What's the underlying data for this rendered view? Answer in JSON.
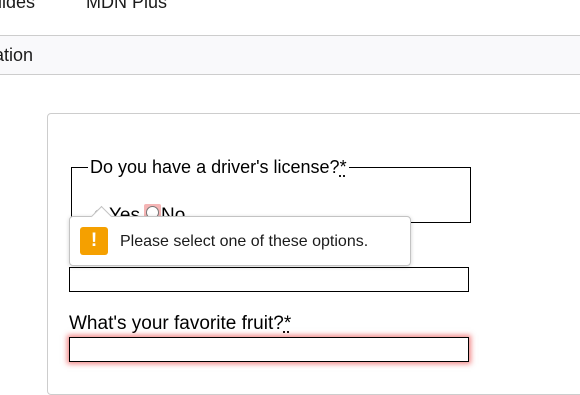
{
  "top_nav": {
    "items": [
      "Guides",
      "MDN Plus"
    ]
  },
  "sub_nav": {
    "title_fragment": "ation"
  },
  "form": {
    "licence_question": "Do you have a driver's license?",
    "required_marker": "*",
    "options": {
      "yes": "Yes",
      "no": "No"
    },
    "fruit_question": "What's your favorite fruit?",
    "fruit_value": ""
  },
  "validation_tooltip": {
    "icon": "warning-icon",
    "icon_glyph": "!",
    "message": "Please select one of these options.",
    "accent_color": "#f5a000"
  },
  "colors": {
    "invalid_highlight": "#f5b5b5",
    "invalid_glow": "#e82828"
  }
}
